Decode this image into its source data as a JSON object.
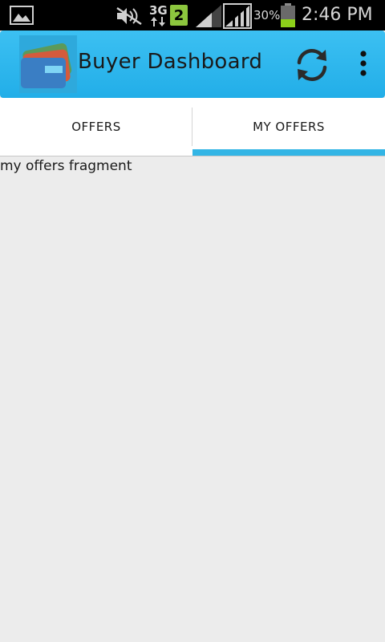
{
  "status_bar": {
    "time": "2:46 PM",
    "battery_percent": "30%",
    "network_type": "3G",
    "sim_slot": "2",
    "icons": [
      "gallery-icon",
      "mute-icon",
      "3g-data-icon",
      "sim-2-icon",
      "signal-icon",
      "signal-full-icon",
      "battery-icon"
    ]
  },
  "action_bar": {
    "title": "Buyer Dashboard",
    "logo_icon": "wallet-cards-icon",
    "refresh_icon": "refresh-icon",
    "overflow_icon": "overflow-menu-icon"
  },
  "tabs": [
    {
      "label": "OFFERS",
      "selected": false
    },
    {
      "label": "MY OFFERS",
      "selected": true
    }
  ],
  "content": {
    "fragment_text": "my offers fragment"
  },
  "colors": {
    "action_bar": "#22aee8",
    "tab_indicator": "#33b5e5",
    "background": "#ececec",
    "status_bar": "#000000"
  }
}
